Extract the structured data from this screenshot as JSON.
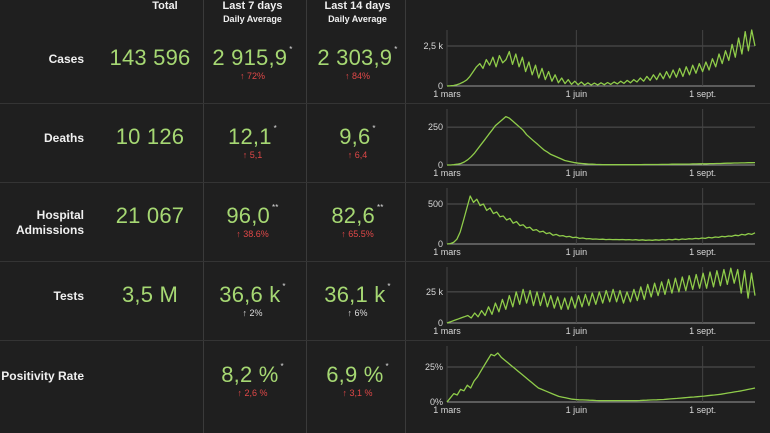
{
  "headers": {
    "total": "Total",
    "last7": "Last 7 days",
    "last7_sub": "Daily Average",
    "last14": "Last 14 days",
    "last14_sub": "Daily Average"
  },
  "rows": [
    {
      "label_lines": [
        "Cases"
      ],
      "total": "143 596",
      "avg7": "2 915,9",
      "avg7_mark": "*",
      "chg7": "↑ 72%",
      "chg7_color": "#e04848",
      "avg14": "2 303,9",
      "avg14_mark": "*",
      "chg14": "↑ 84%",
      "chg14_color": "#e04848"
    },
    {
      "label_lines": [
        "Deaths"
      ],
      "total": "10 126",
      "avg7": "12,1",
      "avg7_mark": "*",
      "chg7": "↑ 5,1",
      "chg7_color": "#e04848",
      "avg14": "9,6",
      "avg14_mark": "*",
      "chg14": "↑ 6,4",
      "chg14_color": "#e04848"
    },
    {
      "label_lines": [
        "Hospital",
        "Admissions"
      ],
      "total": "21 067",
      "avg7": "96,0",
      "avg7_mark": "**",
      "chg7": "↑ 38.6%",
      "chg7_color": "#e04848",
      "avg14": "82,6",
      "avg14_mark": "**",
      "chg14": "↑ 65.5%",
      "chg14_color": "#e04848"
    },
    {
      "label_lines": [
        "Tests"
      ],
      "total": "3,5 M",
      "avg7": "36,6 k",
      "avg7_mark": "*",
      "chg7": "↑ 2%",
      "chg7_color": "#dddddd",
      "avg14": "36,1 k",
      "avg14_mark": "*",
      "chg14": "↑ 6%",
      "chg14_color": "#dddddd"
    },
    {
      "label_lines": [
        "Positivity Rate"
      ],
      "total": "",
      "avg7": "8,2 %",
      "avg7_mark": "*",
      "chg7": "↑ 2,6 %",
      "chg7_color": "#e04848",
      "avg14": "6,9 %",
      "avg14_mark": "*",
      "chg14": "↑ 3,1 %",
      "chg14_color": "#e04848"
    }
  ],
  "chart_data": [
    {
      "type": "line",
      "series_label": "Cases",
      "x_labels": [
        "1 mars",
        "1 juin",
        "1 sept."
      ],
      "y_ticks": [
        "0",
        "2,5 k"
      ],
      "y_tick_values": [
        0,
        2500
      ],
      "ylim": [
        0,
        3500
      ],
      "values": [
        0,
        10,
        30,
        80,
        150,
        250,
        380,
        600,
        900,
        1200,
        1400,
        1100,
        1650,
        1300,
        1800,
        1200,
        1900,
        1450,
        1650,
        2150,
        1350,
        2000,
        1200,
        1800,
        900,
        1500,
        700,
        1300,
        500,
        1100,
        400,
        900,
        300,
        700,
        200,
        500,
        150,
        400,
        100,
        300,
        80,
        250,
        60,
        200,
        60,
        180,
        70,
        200,
        80,
        220,
        100,
        250,
        130,
        300,
        160,
        350,
        200,
        400,
        250,
        500,
        300,
        600,
        350,
        700,
        400,
        800,
        450,
        900,
        500,
        1000,
        550,
        1100,
        600,
        1200,
        700,
        1300,
        800,
        1400,
        900,
        1500,
        1000,
        1700,
        1200,
        2000,
        1400,
        2200,
        1600,
        2600,
        1800,
        3000,
        2000,
        3400,
        2200,
        3800,
        2500
      ]
    },
    {
      "type": "line",
      "series_label": "Deaths",
      "x_labels": [
        "1 mars",
        "1 juin",
        "1 sept."
      ],
      "y_ticks": [
        "0",
        "250"
      ],
      "y_tick_values": [
        0,
        250
      ],
      "ylim": [
        0,
        370
      ],
      "values": [
        0,
        0,
        2,
        5,
        10,
        20,
        35,
        55,
        80,
        110,
        140,
        170,
        200,
        230,
        260,
        280,
        300,
        320,
        310,
        290,
        270,
        250,
        230,
        200,
        180,
        160,
        140,
        120,
        100,
        85,
        70,
        60,
        50,
        40,
        30,
        25,
        20,
        15,
        12,
        10,
        8,
        6,
        5,
        4,
        3,
        2,
        2,
        2,
        2,
        2,
        2,
        2,
        2,
        2,
        2,
        2,
        2,
        3,
        3,
        3,
        3,
        3,
        4,
        4,
        4,
        5,
        5,
        5,
        6,
        6,
        6,
        7,
        7,
        8,
        8,
        8,
        9,
        9,
        10,
        10,
        11,
        12,
        12,
        13,
        13,
        14,
        14,
        15,
        15,
        16
      ]
    },
    {
      "type": "line",
      "series_label": "Hospital Admissions",
      "x_labels": [
        "1 mars",
        "1 juin",
        "1 sept."
      ],
      "y_ticks": [
        "0",
        "500"
      ],
      "y_tick_values": [
        0,
        500
      ],
      "ylim": [
        0,
        700
      ],
      "values": [
        0,
        5,
        20,
        60,
        150,
        300,
        450,
        600,
        520,
        560,
        480,
        500,
        420,
        450,
        380,
        400,
        340,
        350,
        300,
        320,
        260,
        280,
        230,
        240,
        200,
        210,
        170,
        180,
        150,
        160,
        130,
        140,
        110,
        120,
        100,
        105,
        90,
        95,
        80,
        85,
        70,
        75,
        65,
        68,
        60,
        62,
        58,
        60,
        55,
        58,
        55,
        56,
        54,
        56,
        52,
        55,
        50,
        54,
        48,
        52,
        46,
        50,
        46,
        52,
        48,
        55,
        50,
        58,
        52,
        60,
        54,
        62,
        58,
        66,
        62,
        70,
        66,
        75,
        70,
        82,
        76,
        88,
        82,
        95,
        90,
        100,
        96,
        110,
        104,
        120,
        112,
        130,
        120,
        140
      ]
    },
    {
      "type": "line",
      "series_label": "Tests",
      "x_labels": [
        "1 mars",
        "1 juin",
        "1 sept."
      ],
      "y_ticks": [
        "0",
        "25 k"
      ],
      "y_tick_values": [
        0,
        25000
      ],
      "ylim": [
        0,
        45000
      ],
      "values": [
        0,
        1000,
        2000,
        3000,
        4000,
        5000,
        6000,
        4000,
        8000,
        5000,
        10000,
        6000,
        13000,
        7000,
        16000,
        9000,
        19000,
        11000,
        22000,
        13000,
        25000,
        15000,
        27000,
        16000,
        26000,
        14000,
        25000,
        14000,
        24000,
        13000,
        22000,
        12000,
        21000,
        11000,
        20000,
        11000,
        21000,
        12000,
        22000,
        13000,
        23000,
        14000,
        24000,
        15000,
        25000,
        16000,
        26000,
        17000,
        27000,
        17000,
        26000,
        16000,
        25000,
        17000,
        27000,
        18000,
        29000,
        19000,
        31000,
        21000,
        32000,
        22000,
        33000,
        23000,
        35000,
        24000,
        36000,
        25000,
        37000,
        26000,
        38000,
        27000,
        39000,
        28000,
        40000,
        28000,
        41000,
        29000,
        42000,
        30000,
        43000,
        31000,
        44000,
        32000,
        43000,
        24000,
        42000,
        20000,
        40000,
        22000
      ]
    },
    {
      "type": "line",
      "series_label": "Positivity Rate",
      "x_labels": [
        "1 mars",
        "1 juin",
        "1 sept."
      ],
      "y_ticks": [
        "0%",
        "25%"
      ],
      "y_tick_values": [
        0,
        25
      ],
      "ylim": [
        0,
        40
      ],
      "values": [
        0,
        3,
        6,
        5,
        9,
        8,
        12,
        10,
        15,
        18,
        22,
        26,
        30,
        34,
        33,
        35,
        32,
        30,
        28,
        26,
        24,
        22,
        20,
        18,
        16,
        14,
        12,
        10,
        9,
        8,
        7,
        6,
        5,
        4,
        3.5,
        3,
        2.5,
        2,
        1.8,
        1.6,
        1.5,
        1.4,
        1.3,
        1.2,
        1.1,
        1,
        1,
        1,
        1,
        1,
        1,
        1,
        1,
        1,
        1,
        1,
        1,
        1.1,
        1.2,
        1.3,
        1.4,
        1.5,
        1.6,
        1.7,
        1.8,
        2,
        2.2,
        2.4,
        2.6,
        2.8,
        3,
        3.2,
        3.4,
        3.6,
        3.8,
        4,
        4.2,
        4.5,
        4.8,
        5,
        5.3,
        5.6,
        6,
        6.4,
        6.8,
        7.2,
        7.6,
        8,
        8.5,
        9,
        9.5,
        10
      ]
    }
  ]
}
